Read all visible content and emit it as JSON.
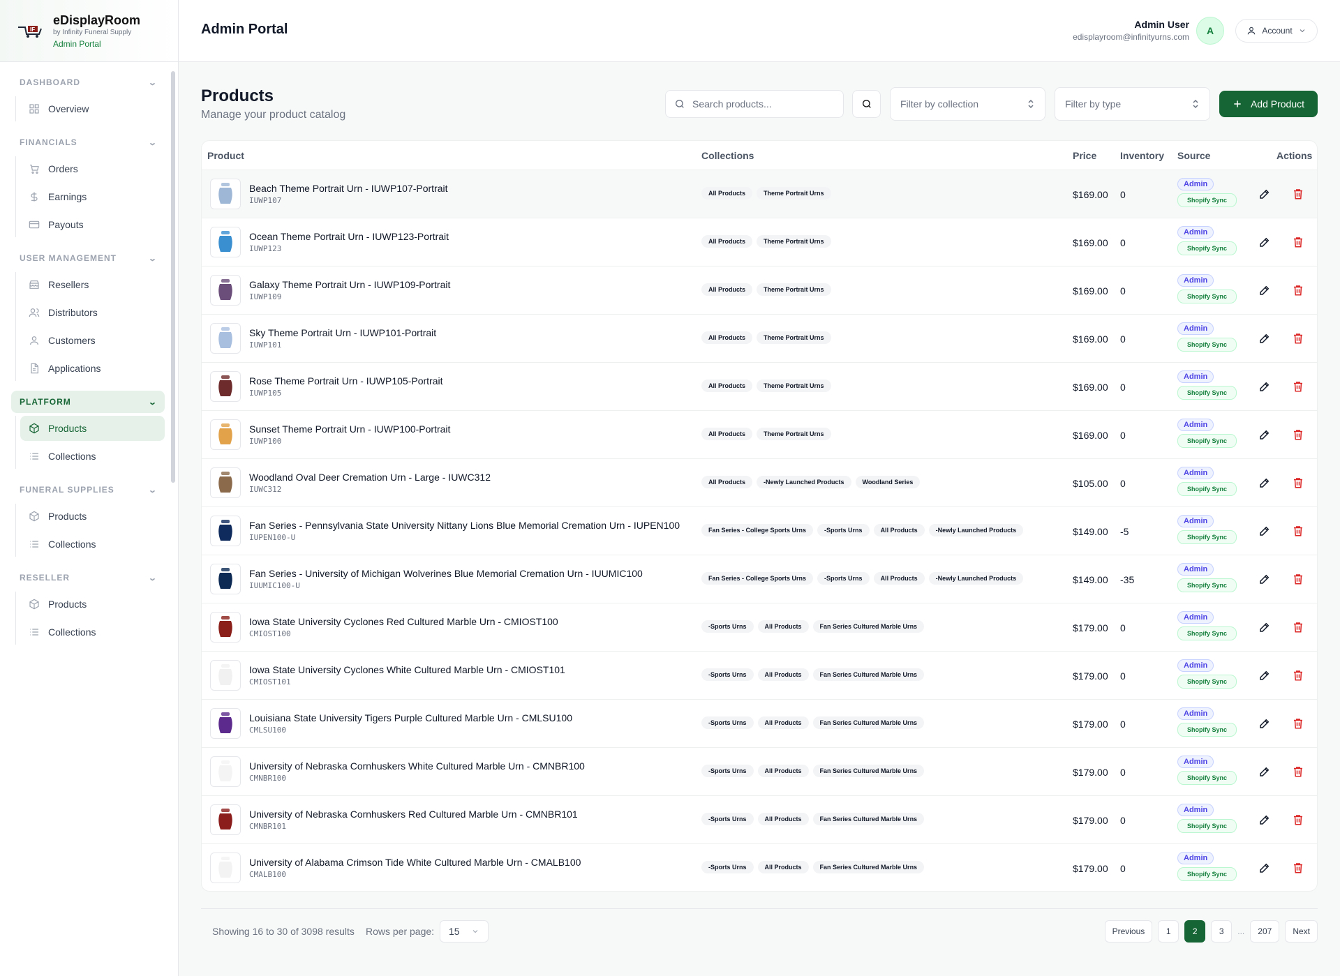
{
  "brand": {
    "title": "eDisplayRoom",
    "subtitle": "by Infinity Funeral Supply",
    "portal": "Admin Portal"
  },
  "header": {
    "title": "Admin Portal",
    "user_name": "Admin User",
    "user_email": "edisplayroom@infinityurns.com",
    "avatar_letter": "A",
    "account_label": "Account"
  },
  "sidebar": {
    "sections": [
      {
        "title": "DASHBOARD",
        "items": [
          {
            "label": "Overview",
            "icon": "grid-icon"
          }
        ]
      },
      {
        "title": "FINANCIALS",
        "items": [
          {
            "label": "Orders",
            "icon": "cart-icon"
          },
          {
            "label": "Earnings",
            "icon": "dollar-icon"
          },
          {
            "label": "Payouts",
            "icon": "card-icon"
          }
        ]
      },
      {
        "title": "USER MANAGEMENT",
        "items": [
          {
            "label": "Resellers",
            "icon": "store-icon"
          },
          {
            "label": "Distributors",
            "icon": "users-icon"
          },
          {
            "label": "Customers",
            "icon": "user-icon"
          },
          {
            "label": "Applications",
            "icon": "file-icon"
          }
        ]
      },
      {
        "title": "PLATFORM",
        "active": true,
        "items": [
          {
            "label": "Products",
            "icon": "box-icon",
            "active": true
          },
          {
            "label": "Collections",
            "icon": "list-icon"
          }
        ]
      },
      {
        "title": "FUNERAL SUPPLIES",
        "items": [
          {
            "label": "Products",
            "icon": "box-icon"
          },
          {
            "label": "Collections",
            "icon": "list-icon"
          }
        ]
      },
      {
        "title": "RESELLER",
        "items": [
          {
            "label": "Products",
            "icon": "box-icon"
          },
          {
            "label": "Collections",
            "icon": "list-icon"
          }
        ]
      }
    ]
  },
  "page": {
    "title": "Products",
    "subtitle": "Manage your product catalog"
  },
  "toolbar": {
    "search_placeholder": "Search products...",
    "filter_collection": "Filter by collection",
    "filter_type": "Filter by type",
    "add_label": "Add Product"
  },
  "table": {
    "columns": {
      "product": "Product",
      "collections": "Collections",
      "price": "Price",
      "inventory": "Inventory",
      "source": "Source",
      "actions": "Actions"
    },
    "source_admin": "Admin",
    "source_sync": "Shopify Sync",
    "rows": [
      {
        "name": "Beach Theme Portrait Urn - IUWP107-Portrait",
        "sku": "IUWP107",
        "tags": [
          "All Products",
          "Theme Portrait Urns"
        ],
        "price": "$169.00",
        "inventory": "0",
        "thumb": "#9fb7d6"
      },
      {
        "name": "Ocean Theme Portrait Urn - IUWP123-Portrait",
        "sku": "IUWP123",
        "tags": [
          "All Products",
          "Theme Portrait Urns"
        ],
        "price": "$169.00",
        "inventory": "0",
        "thumb": "#3a8fd1"
      },
      {
        "name": "Galaxy Theme Portrait Urn - IUWP109-Portrait",
        "sku": "IUWP109",
        "tags": [
          "All Products",
          "Theme Portrait Urns"
        ],
        "price": "$169.00",
        "inventory": "0",
        "thumb": "#6b4e7a"
      },
      {
        "name": "Sky Theme Portrait Urn - IUWP101-Portrait",
        "sku": "IUWP101",
        "tags": [
          "All Products",
          "Theme Portrait Urns"
        ],
        "price": "$169.00",
        "inventory": "0",
        "thumb": "#a9bfe0"
      },
      {
        "name": "Rose Theme Portrait Urn - IUWP105-Portrait",
        "sku": "IUWP105",
        "tags": [
          "All Products",
          "Theme Portrait Urns"
        ],
        "price": "$169.00",
        "inventory": "0",
        "thumb": "#6e2b2b"
      },
      {
        "name": "Sunset Theme Portrait Urn - IUWP100-Portrait",
        "sku": "IUWP100",
        "tags": [
          "All Products",
          "Theme Portrait Urns"
        ],
        "price": "$169.00",
        "inventory": "0",
        "thumb": "#e2a24a"
      },
      {
        "name": "Woodland Oval Deer Cremation Urn - Large - IUWC312",
        "sku": "IUWC312",
        "tags": [
          "All Products",
          "-Newly Launched Products",
          "Woodland Series"
        ],
        "price": "$105.00",
        "inventory": "0",
        "thumb": "#8a6a4a"
      },
      {
        "name": "Fan Series - Pennsylvania State University Nittany Lions Blue Memorial Cremation Urn - IUPEN100",
        "sku": "IUPEN100-U",
        "tags": [
          "Fan Series - College Sports Urns",
          "-Sports Urns",
          "All Products",
          "-Newly Launched Products"
        ],
        "price": "$149.00",
        "inventory": "-5",
        "thumb": "#0f2a5c"
      },
      {
        "name": "Fan Series - University of Michigan Wolverines Blue Memorial Cremation Urn - IUUMIC100",
        "sku": "IUUMIC100-U",
        "tags": [
          "Fan Series - College Sports Urns",
          "-Sports Urns",
          "All Products",
          "-Newly Launched Products"
        ],
        "price": "$149.00",
        "inventory": "-35",
        "thumb": "#0d2a55"
      },
      {
        "name": "Iowa State University Cyclones Red Cultured Marble Urn - CMIOST100",
        "sku": "CMIOST100",
        "tags": [
          "-Sports Urns",
          "All Products",
          "Fan Series Cultured Marble Urns"
        ],
        "price": "$179.00",
        "inventory": "0",
        "thumb": "#8b1f1a"
      },
      {
        "name": "Iowa State University Cyclones White Cultured Marble Urn - CMIOST101",
        "sku": "CMIOST101",
        "tags": [
          "-Sports Urns",
          "All Products",
          "Fan Series Cultured Marble Urns"
        ],
        "price": "$179.00",
        "inventory": "0",
        "thumb": "#f1f1f1"
      },
      {
        "name": "Louisiana State University Tigers Purple Cultured Marble Urn - CMLSU100",
        "sku": "CMLSU100",
        "tags": [
          "-Sports Urns",
          "All Products",
          "Fan Series Cultured Marble Urns"
        ],
        "price": "$179.00",
        "inventory": "0",
        "thumb": "#5b2a8c"
      },
      {
        "name": "University of Nebraska Cornhuskers White Cultured Marble Urn - CMNBR100",
        "sku": "CMNBR100",
        "tags": [
          "-Sports Urns",
          "All Products",
          "Fan Series Cultured Marble Urns"
        ],
        "price": "$179.00",
        "inventory": "0",
        "thumb": "#f4f4f4"
      },
      {
        "name": "University of Nebraska Cornhuskers Red Cultured Marble Urn - CMNBR101",
        "sku": "CMNBR101",
        "tags": [
          "-Sports Urns",
          "All Products",
          "Fan Series Cultured Marble Urns"
        ],
        "price": "$179.00",
        "inventory": "0",
        "thumb": "#8c1d1d"
      },
      {
        "name": "University of Alabama Crimson Tide White Cultured Marble Urn - CMALB100",
        "sku": "CMALB100",
        "tags": [
          "-Sports Urns",
          "All Products",
          "Fan Series Cultured Marble Urns"
        ],
        "price": "$179.00",
        "inventory": "0",
        "thumb": "#f3f3f3"
      }
    ]
  },
  "pagination": {
    "showing": "Showing 16 to 30 of 3098 results",
    "rows_label": "Rows per page:",
    "rows_value": "15",
    "prev": "Previous",
    "next": "Next",
    "pages": [
      "1",
      "2",
      "3",
      "207"
    ],
    "current": "2",
    "ellipsis": "..."
  },
  "colors": {
    "brand_green": "#166534",
    "admin_badge": "#4f46e5",
    "sync_badge": "#15803d",
    "delete_red": "#dc2626"
  }
}
